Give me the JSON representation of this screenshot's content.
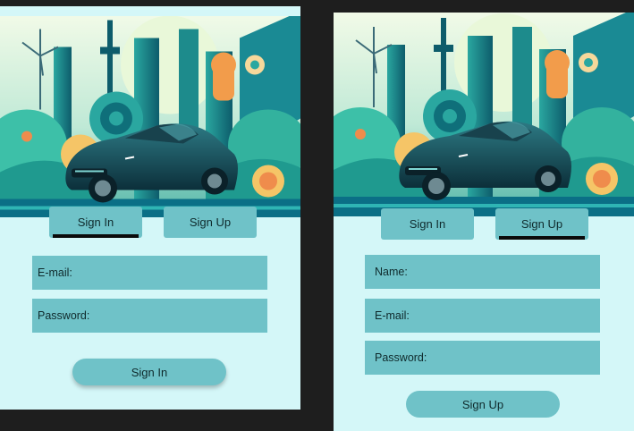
{
  "signin_panel": {
    "tabs": [
      {
        "label": "Sign In",
        "active": true
      },
      {
        "label": "Sign Up",
        "active": false
      }
    ],
    "fields": [
      {
        "label": "E-mail:"
      },
      {
        "label": "Password:"
      }
    ],
    "submit_label": "Sign In"
  },
  "signup_panel": {
    "tabs": [
      {
        "label": "Sign In",
        "active": false
      },
      {
        "label": "Sign Up",
        "active": true
      }
    ],
    "fields": [
      {
        "label": "Name:"
      },
      {
        "label": "E-mail:"
      },
      {
        "label": "Password:"
      }
    ],
    "submit_label": "Sign Up"
  },
  "colors": {
    "background": "#1e1e1e",
    "panel": "#d4f7f8",
    "control": "#6fc2c8",
    "active_indicator": "#0a0a0a"
  }
}
